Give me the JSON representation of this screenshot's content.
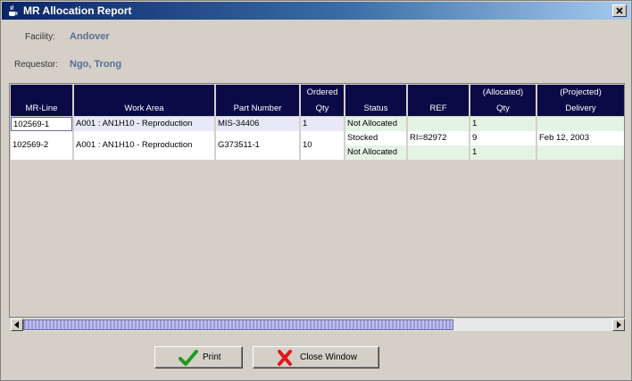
{
  "window": {
    "title": "MR Allocation Report",
    "title_icon": "coffee-cup-icon",
    "close_icon": "close-icon"
  },
  "fields": {
    "facility_label": "Facility:",
    "facility_value": "Andover",
    "requestor_label": "Requestor:",
    "requestor_value": "Ngo, Trong"
  },
  "table": {
    "headers": {
      "mr_line": "MR-Line",
      "work_area": "Work Area",
      "part_number": "Part Number",
      "ordered_top": "Ordered",
      "ordered_bottom": "Qty",
      "status": "Status",
      "ref": "REF",
      "allocated_top": "(Allocated)",
      "allocated_bottom": "Qty",
      "projected_top": "(Projected)",
      "projected_bottom": "Delivery"
    },
    "rows": [
      {
        "mr_line": "102569-1",
        "work_area": "A001 : AN1H10 - Reproduction",
        "part_number": "MIS-34406",
        "ordered_qty": "1",
        "status": "Not Allocated",
        "ref": "",
        "allocated_qty": "1",
        "projected_delivery": ""
      },
      {
        "mr_line": "102569-2",
        "work_area": "A001 : AN1H10 - Reproduction",
        "part_number": "G373511-1",
        "ordered_qty": "10",
        "sub_rows": [
          {
            "status": "Stocked",
            "ref": "RI=82972",
            "allocated_qty": "9",
            "projected_delivery": "Feb 12, 2003"
          },
          {
            "status": "Not Allocated",
            "ref": "",
            "allocated_qty": "1",
            "projected_delivery": ""
          }
        ]
      }
    ]
  },
  "scrollbar": {
    "left_icon": "arrow-left-icon",
    "right_icon": "arrow-right-icon",
    "thumb_fraction": 0.73
  },
  "buttons": {
    "print_label": "Print",
    "print_icon": "checkmark-icon",
    "close_label": "Close Window",
    "close_icon": "red-x-icon"
  },
  "colors": {
    "header_bg": "#0a0a47",
    "label_value": "#5a6a95",
    "status_bg": "#e4f4e4"
  }
}
